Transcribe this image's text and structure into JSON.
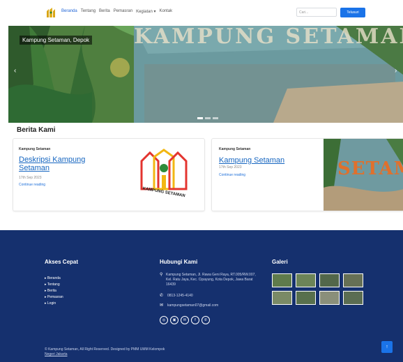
{
  "nav": {
    "links": [
      "Beranda",
      "Tentang",
      "Berita",
      "Pemasran",
      "Kegiatan ▾",
      "Kontak"
    ],
    "search_placeholder": "Cari...",
    "search_button": "Telusuri"
  },
  "hero": {
    "caption": "Kampung Setaman, Depok",
    "mural_text": "KAMPUNG SETAMAN",
    "prev_icon": "‹",
    "next_icon": "›"
  },
  "berita": {
    "title": "Berita Kami",
    "cards": [
      {
        "category": "Kampung Setaman",
        "title": "Deskripsi Kampung Setaman",
        "date": "17th Sep 2023",
        "link": "Continue reading",
        "logo_text": "KAMPUNG SETAMAN"
      },
      {
        "category": "Kampung Setaman",
        "title": "Kampung Setaman",
        "date": "17th Sep 2023",
        "link": "Continue reading",
        "image_text": "SETAM"
      }
    ]
  },
  "footer": {
    "akses_title": "Akses Cepat",
    "akses_links": [
      "Beranda",
      "Tentang",
      "Berita",
      "Pemasran",
      "Login"
    ],
    "hubungi_title": "Hubungi Kami",
    "address": "Kampung Setaman, Jl. Rawa Geni Raya, RT.005/RW.007, Kel. Ratu Jaya, Kec. Cipayung, Kota Depok, Jawa Barat 16439",
    "phone": "0813-1245-4140",
    "email": "kampungsetaman07@gmail.com",
    "socials": [
      "◎",
      "▣",
      "✉",
      "f",
      "✆"
    ],
    "galeri_title": "Galeri",
    "copyright_line1": "© Kampung Setaman, All Right Reserved. Designed by PMM UMM Kelompok",
    "copyright_line2": "Negeri Jakarta",
    "back_top": "↑"
  },
  "colors": {
    "brand": "#1a73e8",
    "footer_bg": "#15306e",
    "link": "#1565c0"
  }
}
